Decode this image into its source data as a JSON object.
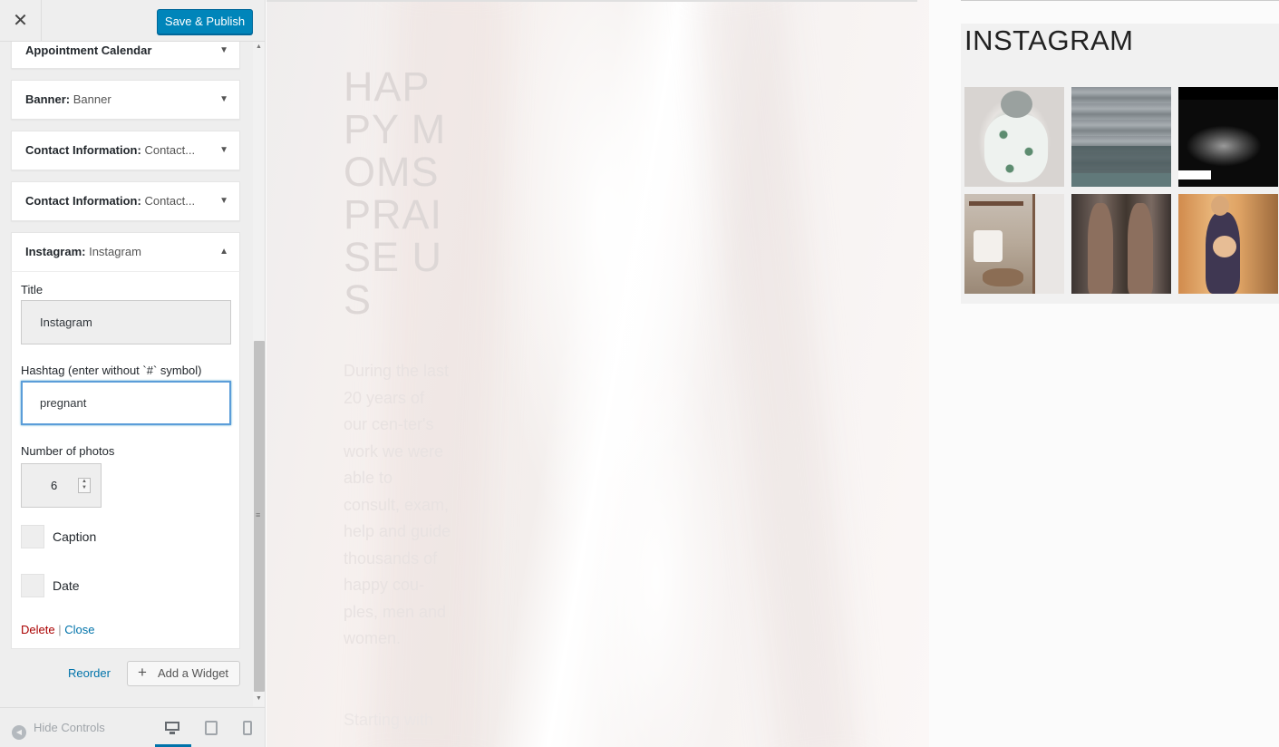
{
  "header": {
    "close_glyph": "✕",
    "publish_label": "Save & Publish"
  },
  "widgets": [
    {
      "type": "Appointment Calendar",
      "name": ""
    },
    {
      "type": "Banner:",
      "name": "Banner"
    },
    {
      "type": "Contact Information:",
      "name": "Contact..."
    },
    {
      "type": "Contact Information:",
      "name": "Contact..."
    },
    {
      "type": "Instagram:",
      "name": "Instagram"
    }
  ],
  "instagram_form": {
    "title_label": "Title",
    "title_value": "Instagram",
    "hashtag_label": "Hashtag (enter without `#` symbol)",
    "hashtag_value": "pregnant",
    "photos_label": "Number of photos",
    "photos_value": "6",
    "caption_label": "Caption",
    "date_label": "Date",
    "delete_label": "Delete",
    "separator": "|",
    "close_label": "Close"
  },
  "actions": {
    "reorder_label": "Reorder",
    "add_widget_label": "Add a Widget"
  },
  "footer": {
    "hide_controls_label": "Hide Controls",
    "active_device": "desktop"
  },
  "preview": {
    "hero_title": "HAPPY MOMS PRAISE US",
    "hero_text": "During the last 20 years of our cen-ter's work we were able to consult, exam, help and guide thousands of happy cou-ples, men and women.",
    "hero_more": "Starting with",
    "instagram_title": "INSTAGRAM"
  },
  "colors": {
    "primary_button": "#0085ba",
    "link": "#0073aa",
    "delete": "#aa0000",
    "focus_border": "#5b9dd9"
  }
}
